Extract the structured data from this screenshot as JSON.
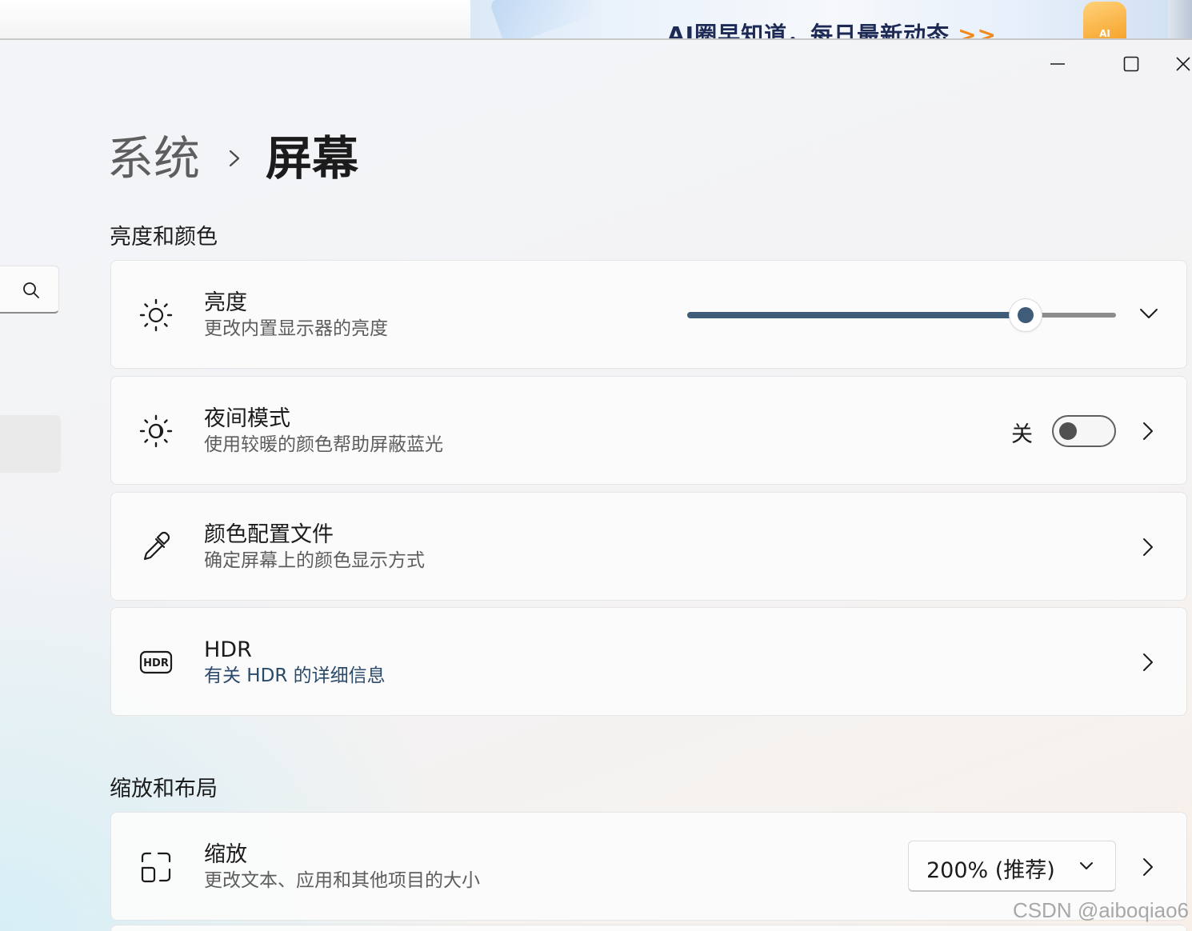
{
  "banner": {
    "text": "AI圈早知道，每日最新动态",
    "arrows": ">>",
    "logo_text": "AI"
  },
  "breadcrumb": {
    "parent": "系统",
    "current": "屏幕"
  },
  "sections": {
    "brightness_color": "亮度和颜色",
    "scale_layout": "缩放和布局"
  },
  "brightness": {
    "title": "亮度",
    "subtitle": "更改内置显示器的亮度",
    "level_fraction": 0.79,
    "icon": "sun-icon"
  },
  "night_light": {
    "title": "夜间模式",
    "subtitle": "使用较暖的颜色帮助屏蔽蓝光",
    "state_label": "关",
    "enabled": false,
    "icon": "night-light-icon"
  },
  "color_profile": {
    "title": "颜色配置文件",
    "subtitle": "确定屏幕上的颜色显示方式",
    "icon": "eyedropper-icon"
  },
  "hdr": {
    "title": "HDR",
    "subtitle": "有关 HDR 的详细信息",
    "icon": "hdr-icon"
  },
  "scale": {
    "title": "缩放",
    "subtitle": "更改文本、应用和其他项目的大小",
    "selected": "200% (推荐)",
    "icon": "scale-icon"
  },
  "watermark": "CSDN @aiboqiao6",
  "colors": {
    "accent": "#3f5c78"
  }
}
